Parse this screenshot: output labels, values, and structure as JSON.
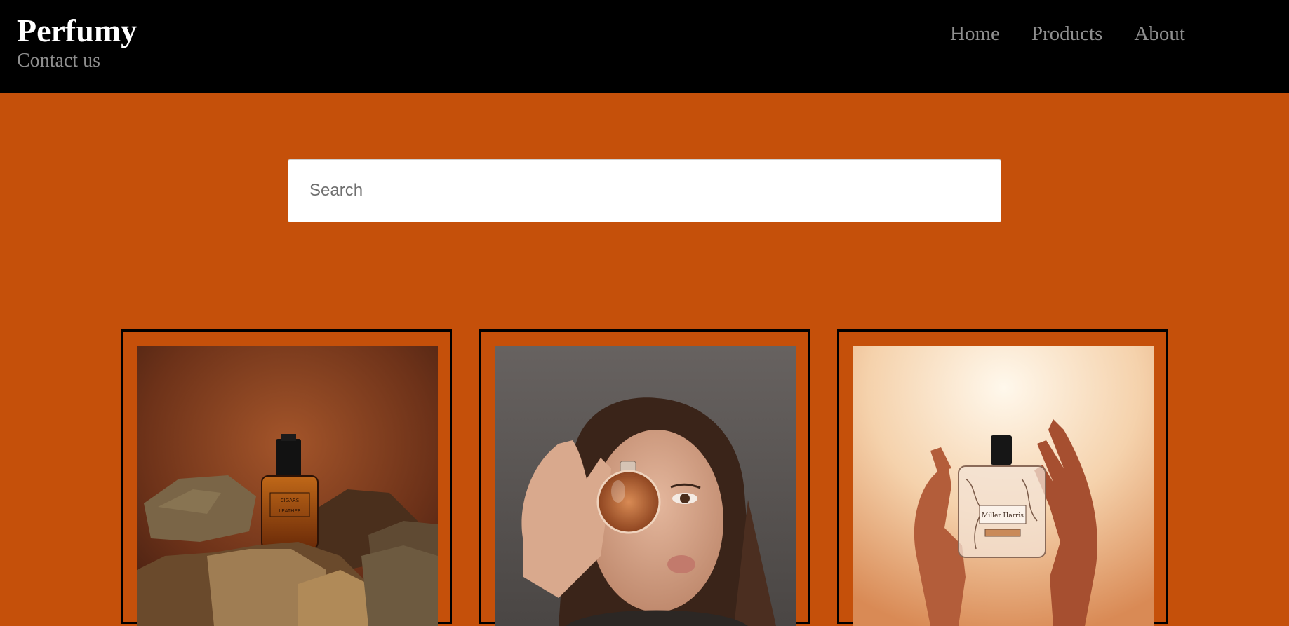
{
  "header": {
    "brand": "Perfumy",
    "contact_label": "Contact us",
    "nav": [
      {
        "label": "Home"
      },
      {
        "label": "Products"
      },
      {
        "label": "About"
      }
    ]
  },
  "search": {
    "placeholder": "Search",
    "value": ""
  },
  "products": [
    {
      "image": "perfume-bottle-on-rocks-photo",
      "bottle_label": "CIGARS & LEATHER"
    },
    {
      "image": "woman-holding-perfume-to-eye-photo"
    },
    {
      "image": "hands-holding-perfume-bottle-photo",
      "bottle_label": "Miller Harris"
    }
  ],
  "colors": {
    "page_background": "#c5500a",
    "header_background": "#000000",
    "brand_text": "#ffffff",
    "nav_text": "#8f8f8f",
    "card_border": "#000000"
  }
}
